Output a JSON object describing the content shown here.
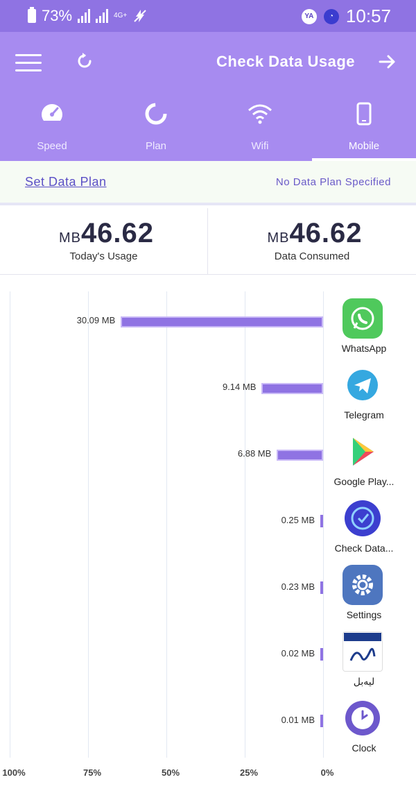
{
  "status_bar": {
    "time": "10:57",
    "battery": "73%",
    "network": "4G+",
    "badge": "YA"
  },
  "header": {
    "title": "Check Data Usage"
  },
  "tabs": [
    {
      "label": "Mobile",
      "active": true
    },
    {
      "label": "Wifi",
      "active": false
    },
    {
      "label": "Plan",
      "active": false
    },
    {
      "label": "Speed",
      "active": false
    }
  ],
  "plan": {
    "status": "No Data Plan Specified",
    "action": "Set Data Plan"
  },
  "summary": {
    "consumed": {
      "value": "46.62",
      "unit": "MB",
      "label": "Data Consumed"
    },
    "today": {
      "value": "46.62",
      "unit": "MB",
      "label": "Today's Usage"
    }
  },
  "chart_data": {
    "type": "bar",
    "orientation": "horizontal",
    "categories": [
      "WhatsApp",
      "Telegram",
      "Google Play...",
      "Check Data...",
      "Settings",
      "ليه‌بل",
      "Clock"
    ],
    "values_mb": [
      30.09,
      9.14,
      6.88,
      0.25,
      0.23,
      0.02,
      0.01
    ],
    "value_labels": [
      "30.09 MB",
      "9.14 MB",
      "6.88 MB",
      "0.25 MB",
      "0.23 MB",
      "0.02 MB",
      "0.01 MB"
    ],
    "x_ticks": [
      "0%",
      "25%",
      "50%",
      "75%",
      "100%"
    ],
    "xlim": [
      0,
      100
    ],
    "bar_color": "#8f73e3"
  },
  "colors": {
    "primary": "#a78bf0",
    "status_bar": "#8f73e3",
    "accent": "#5b4fc6"
  }
}
